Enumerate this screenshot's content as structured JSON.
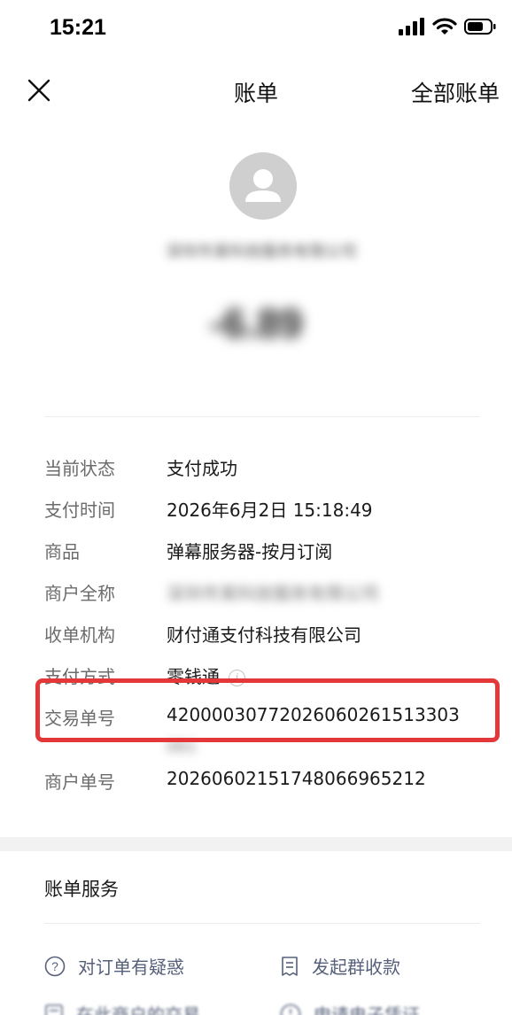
{
  "status_bar": {
    "time": "15:21"
  },
  "nav": {
    "title": "账单",
    "all_bills": "全部账单"
  },
  "bill": {
    "merchant_name": "深圳市某科技服务有限公司",
    "amount": "-6.89"
  },
  "details": {
    "rows": [
      {
        "label": "当前状态",
        "value": "支付成功"
      },
      {
        "label": "支付时间",
        "value": "2026年6月2日 15:18:49"
      },
      {
        "label": "商品",
        "value": "弹幕服务器-按月订阅"
      },
      {
        "label": "商户全称",
        "value": "深圳市某科技服务有限公司"
      },
      {
        "label": "收单机构",
        "value": "财付通支付科技有限公司"
      },
      {
        "label": "支付方式",
        "value": "零钱通"
      },
      {
        "label": "交易单号",
        "value": "42000030772026060261513303",
        "value_extra": "061"
      },
      {
        "label": "商户单号",
        "value": "20260602151748066965212"
      }
    ]
  },
  "services": {
    "title": "账单服务",
    "items": [
      {
        "label": "对订单有疑惑",
        "icon": "question-circle-icon"
      },
      {
        "label": "发起群收款",
        "icon": "receipt-icon"
      },
      {
        "label": "在此商户的交易",
        "icon": "list-icon"
      },
      {
        "label": "申请电子凭证",
        "icon": "clock-icon"
      }
    ]
  },
  "colors": {
    "highlight": "#e4373a",
    "service_text": "#56607a",
    "label_text": "#6b6b6b"
  }
}
